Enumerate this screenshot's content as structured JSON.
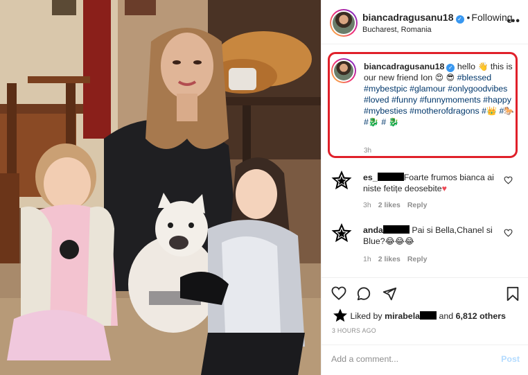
{
  "post": {
    "username": "biancadragusanu18",
    "verified_glyph": "✓",
    "follow_separator": "•",
    "follow_label": "Following",
    "location": "Bucharest, Romania",
    "more_icon": "more-horizontal-icon",
    "more_glyph": "•••"
  },
  "caption": {
    "username": "biancadragusanu18",
    "parts": [
      " hello ",
      "👋",
      " this is our new friend Ion ",
      "😍",
      "😎"
    ],
    "hashtags": [
      "#blessed",
      "#mybestpic",
      "#glamour",
      "#onlygoodvibes",
      "#loved",
      "#funny",
      "#funnymoments",
      "#happy",
      "#mybesties",
      "#motherofdragons",
      "#",
      "#",
      "#",
      "#"
    ],
    "emojis": [
      "👑",
      "🐎",
      "🐉",
      "🐉"
    ],
    "time": "3h"
  },
  "comments": [
    {
      "user": "es_",
      "text": "Foarte frumos bianca ai niste fetițe deosebite",
      "emoji": "♥",
      "time": "3h",
      "likes": "2 likes",
      "reply": "Reply"
    },
    {
      "user": "anda",
      "text": "Pai si Bella,Chanel si Blue?",
      "emoji": "😂😂😂",
      "time": "1h",
      "likes": "2 likes",
      "reply": "Reply"
    }
  ],
  "likes": {
    "prefix": "Liked by",
    "user": "mirabela",
    "suffix": "and",
    "count": "6,812 others"
  },
  "post_time": "3 HOURS AGO",
  "comment_bar": {
    "placeholder": "Add a comment...",
    "post_label": "Post"
  },
  "colors": {
    "highlight_border": "#e0202a",
    "hashtag": "#00376b",
    "verified": "#3897f0",
    "heart_red": "#ed4956"
  }
}
